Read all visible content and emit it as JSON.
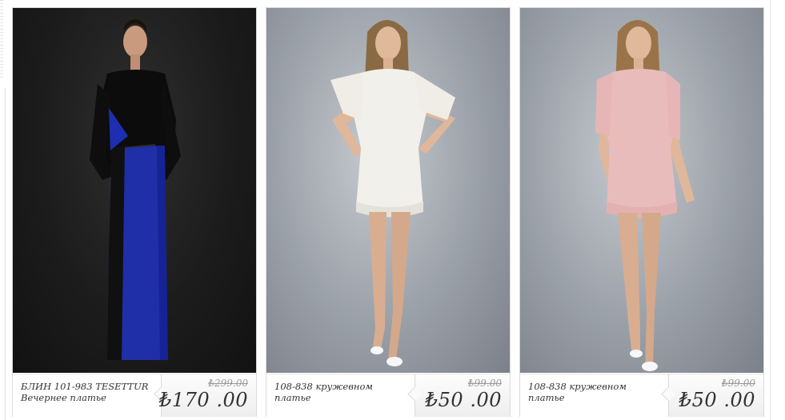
{
  "products": [
    {
      "name_line1": "БЛИН 101-983 TESETTUR",
      "name_line2": "Вечернее платье",
      "old_price": "₺299.00",
      "new_price": "₺170 .00",
      "dress_color": "#1f2fa8"
    },
    {
      "name_line1": "108-838 кружевном",
      "name_line2": "платье",
      "old_price": "₺99.00",
      "new_price": "₺50 .00",
      "dress_color": "#f2f0ea"
    },
    {
      "name_line1": "108-838 кружевном",
      "name_line2": "платье",
      "old_price": "₺99.00",
      "new_price": "₺50 .00",
      "dress_color": "#e9bcbc"
    }
  ]
}
